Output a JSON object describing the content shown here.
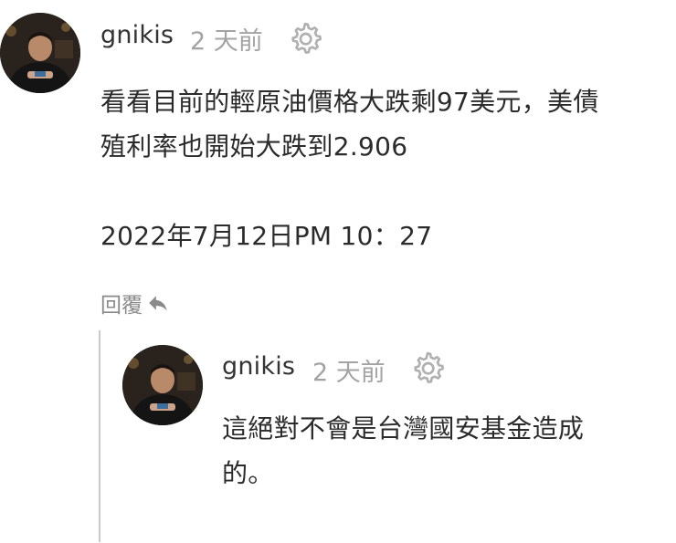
{
  "comments": [
    {
      "username": "gnikis",
      "time": "2 天前",
      "text_lines": [
        "看看目前的輕原油價格大跌剩97美元，美債",
        "殖利率也開始大跌到2.906"
      ],
      "timestamp_line": "2022年7月12日PM 10：27",
      "reply_label": "回覆",
      "avatar": "user-avatar",
      "settings_icon": "gear-icon",
      "reply_icon": "reply-arrow-icon"
    },
    {
      "username": "gnikis",
      "time": "2 天前",
      "text_lines": [
        "這絕對不會是台灣國安基金造成",
        "的。"
      ],
      "avatar": "user-avatar",
      "settings_icon": "gear-icon"
    }
  ],
  "colors": {
    "text": "#2b2b2b",
    "muted": "#a3a3a3",
    "reply": "#8a8a8a",
    "thread_line": "#c9c9c9"
  }
}
